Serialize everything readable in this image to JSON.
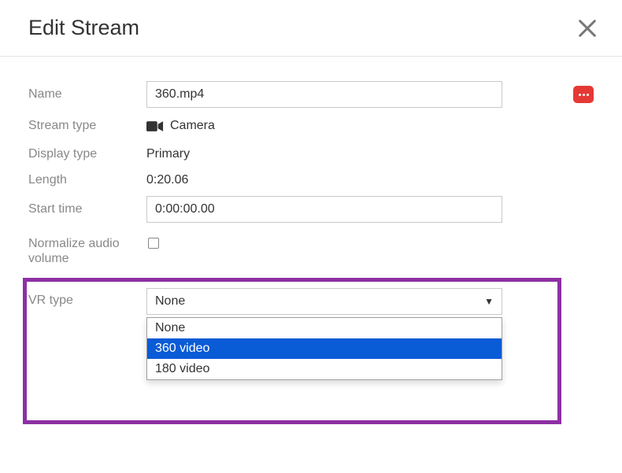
{
  "dialog": {
    "title": "Edit Stream"
  },
  "form": {
    "name_label": "Name",
    "name_value": "360.mp4",
    "stream_type_label": "Stream type",
    "stream_type_value": "Camera",
    "display_type_label": "Display type",
    "display_type_value": "Primary",
    "length_label": "Length",
    "length_value": "0:20.06",
    "start_time_label": "Start time",
    "start_time_value": "0:00:00.00",
    "normalize_label": "Normalize audio volume",
    "vr_label": "VR type",
    "vr_selected": "None",
    "vr_options": {
      "0": "None",
      "1": "360 video",
      "2": "180 video"
    }
  }
}
